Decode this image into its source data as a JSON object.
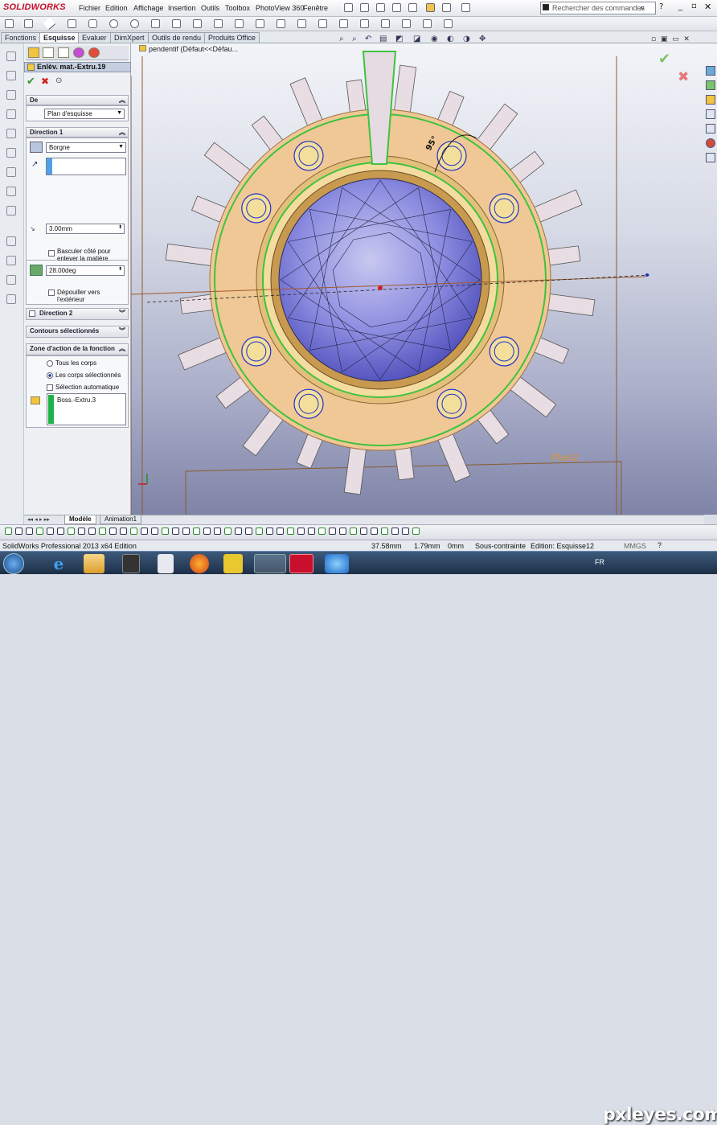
{
  "app": {
    "logo": "SOLIDWORKS"
  },
  "menu": [
    "Fichier",
    "Edition",
    "Affichage",
    "Insertion",
    "Outils",
    "Toolbox",
    "PhotoView 360",
    "Fenêtre"
  ],
  "search": {
    "placeholder": "Rechercher des commandes"
  },
  "tabs": [
    "Fonctions",
    "Esquisse",
    "Evaluer",
    "DimXpert",
    "Outils de rendu",
    "Produits Office"
  ],
  "active_tab": "Esquisse",
  "tree_label": "pendentif  (Défaut<<Défau...",
  "pm": {
    "title": "Enlèv. mat.-Extru.19",
    "de": {
      "header": "De",
      "value": "Plan d'esquisse"
    },
    "dir1": {
      "header": "Direction 1",
      "end_condition": "Borgne",
      "depth": "3.00mm",
      "flip_label": "Basculer côté pour enlever la matière",
      "draft": "28.00deg",
      "draft_outward": "Dépouiller vers l'extérieur"
    },
    "dir2": {
      "header": "Direction 2"
    },
    "contours": {
      "header": "Contours sélectionnés"
    },
    "scope": {
      "header": "Zone d'action de la fonction",
      "all_bodies": "Tous les corps",
      "selected_bodies": "Les corps sélectionnés",
      "auto_select": "Sélection automatique",
      "body": "Boss.-Extru.3"
    }
  },
  "viewport": {
    "plane_label": "Plan2",
    "dim_label": "95°"
  },
  "bottom_tabs": [
    "Modèle",
    "Animation1"
  ],
  "status": {
    "edition": "SolidWorks Professional 2013 x64 Edition",
    "x": "37.58mm",
    "y": "1.79mm",
    "z": "0mm",
    "constraint": "Sous-contrainte",
    "editing": "Edition: Esquisse12",
    "units": "MMGS"
  },
  "taskbar": {
    "lang": "FR",
    "watermark": "pxleyes.com"
  },
  "colors": {
    "accent_red": "#c8102e",
    "ring_orange": "#f0c896",
    "sketch_green": "#3fc23f",
    "sketch_blue": "#1e2fc8"
  }
}
